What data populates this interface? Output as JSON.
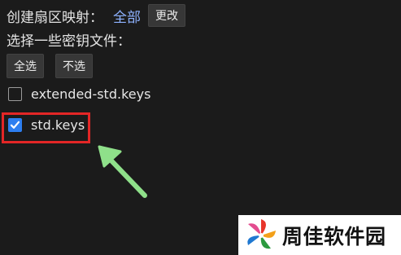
{
  "sector_mapping": {
    "label": "创建扇区映射：",
    "value": "全部",
    "change_button": "更改"
  },
  "choose_keys": {
    "title": "选择一些密钥文件：",
    "select_all_button": "全选",
    "select_none_button": "不选"
  },
  "key_files": [
    {
      "name": "extended-std.keys",
      "checked": false
    },
    {
      "name": "std.keys",
      "checked": true
    }
  ],
  "annotation": {
    "highlight_color": "#e32626",
    "arrow_color": "#8fe08a",
    "highlighted_item": "std.keys"
  },
  "watermark": {
    "text": "周佳软件园"
  },
  "colors": {
    "background": "#1b1b1b",
    "accent_link": "#8eb2ff",
    "checkbox_checked": "#2d7ef0"
  }
}
